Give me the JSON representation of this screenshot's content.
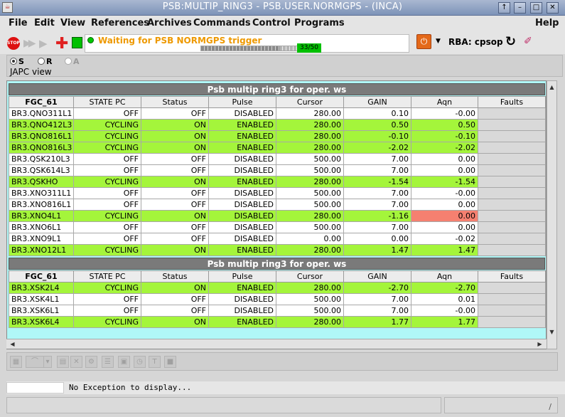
{
  "window": {
    "title": "PSB:MULTIP_RING3 - PSB.USER.NORMGPS - (INCA)",
    "app_icon": "java-icon",
    "buttons": [
      "↑",
      "–",
      "□",
      "✕"
    ]
  },
  "menu": [
    "File",
    "Edit",
    "View",
    "References",
    "Archives",
    "Commands",
    "Control",
    "Programs",
    "Help"
  ],
  "toolbar": {
    "stop_label": "STOP",
    "status_text": "Waiting for PSB NORMGPS trigger",
    "progress": {
      "current": 33,
      "total": 50,
      "label": "33/50"
    },
    "rba_label": "RBA: cpsop",
    "status_color": "#00c800",
    "status_text_color": "#ee9900"
  },
  "radios": [
    {
      "label": "S",
      "selected": true,
      "enabled": true
    },
    {
      "label": "R",
      "selected": false,
      "enabled": true
    },
    {
      "label": "A",
      "selected": false,
      "enabled": false
    }
  ],
  "view_label": "JAPC view",
  "colors": {
    "cycling_row": "#a4f53b",
    "alarm_cell": "#f58070",
    "background": "#b0f7f7"
  },
  "columns": [
    "FGC_61",
    "STATE PC",
    "Status",
    "Pulse",
    "Cursor",
    "GAIN",
    "Aqn",
    "Faults"
  ],
  "sections": [
    {
      "title": "Psb multip ring3 for oper. ws",
      "rows": [
        {
          "name": "BR3.QNO311L1",
          "state": "OFF",
          "status": "OFF",
          "pulse": "DISABLED",
          "cursor": "280.00",
          "gain": "0.10",
          "aqn": "-0.00",
          "faults": "",
          "cycling": false,
          "alarm": false
        },
        {
          "name": "BR3.QNO412L3",
          "state": "CYCLING",
          "status": "ON",
          "pulse": "ENABLED",
          "cursor": "280.00",
          "gain": "0.50",
          "aqn": "0.50",
          "faults": "",
          "cycling": true,
          "alarm": false
        },
        {
          "name": "BR3.QNO816L1",
          "state": "CYCLING",
          "status": "ON",
          "pulse": "ENABLED",
          "cursor": "280.00",
          "gain": "-0.10",
          "aqn": "-0.10",
          "faults": "",
          "cycling": true,
          "alarm": false
        },
        {
          "name": "BR3.QNO816L3",
          "state": "CYCLING",
          "status": "ON",
          "pulse": "ENABLED",
          "cursor": "280.00",
          "gain": "-2.02",
          "aqn": "-2.02",
          "faults": "",
          "cycling": true,
          "alarm": false
        },
        {
          "name": "BR3.QSK210L3",
          "state": "OFF",
          "status": "OFF",
          "pulse": "DISABLED",
          "cursor": "500.00",
          "gain": "7.00",
          "aqn": "0.00",
          "faults": "",
          "cycling": false,
          "alarm": false
        },
        {
          "name": "BR3.QSK614L3",
          "state": "OFF",
          "status": "OFF",
          "pulse": "DISABLED",
          "cursor": "500.00",
          "gain": "7.00",
          "aqn": "0.00",
          "faults": "",
          "cycling": false,
          "alarm": false
        },
        {
          "name": "BR3.QSKHO",
          "state": "CYCLING",
          "status": "ON",
          "pulse": "ENABLED",
          "cursor": "280.00",
          "gain": "-1.54",
          "aqn": "-1.54",
          "faults": "",
          "cycling": true,
          "alarm": false
        },
        {
          "name": "BR3.XNO311L1",
          "state": "OFF",
          "status": "OFF",
          "pulse": "DISABLED",
          "cursor": "500.00",
          "gain": "7.00",
          "aqn": "-0.00",
          "faults": "",
          "cycling": false,
          "alarm": false
        },
        {
          "name": "BR3.XNO816L1",
          "state": "OFF",
          "status": "OFF",
          "pulse": "DISABLED",
          "cursor": "500.00",
          "gain": "7.00",
          "aqn": "0.00",
          "faults": "",
          "cycling": false,
          "alarm": false
        },
        {
          "name": "BR3.XNO4L1",
          "state": "CYCLING",
          "status": "ON",
          "pulse": "DISABLED",
          "cursor": "280.00",
          "gain": "-1.16",
          "aqn": "0.00",
          "faults": "",
          "cycling": true,
          "alarm": true
        },
        {
          "name": "BR3.XNO6L1",
          "state": "OFF",
          "status": "OFF",
          "pulse": "DISABLED",
          "cursor": "500.00",
          "gain": "7.00",
          "aqn": "0.00",
          "faults": "",
          "cycling": false,
          "alarm": false
        },
        {
          "name": "BR3.XNO9L1",
          "state": "OFF",
          "status": "OFF",
          "pulse": "DISABLED",
          "cursor": "0.00",
          "gain": "0.00",
          "aqn": "-0.02",
          "faults": "",
          "cycling": false,
          "alarm": false
        },
        {
          "name": "BR3.XNO12L1",
          "state": "CYCLING",
          "status": "ON",
          "pulse": "ENABLED",
          "cursor": "280.00",
          "gain": "1.47",
          "aqn": "1.47",
          "faults": "",
          "cycling": true,
          "alarm": false
        }
      ]
    },
    {
      "title": "Psb multip ring3 for oper. ws",
      "rows": [
        {
          "name": "BR3.XSK2L4",
          "state": "CYCLING",
          "status": "ON",
          "pulse": "ENABLED",
          "cursor": "280.00",
          "gain": "-2.70",
          "aqn": "-2.70",
          "faults": "",
          "cycling": true,
          "alarm": false
        },
        {
          "name": "BR3.XSK4L1",
          "state": "OFF",
          "status": "OFF",
          "pulse": "DISABLED",
          "cursor": "500.00",
          "gain": "7.00",
          "aqn": "0.01",
          "faults": "",
          "cycling": false,
          "alarm": false
        },
        {
          "name": "BR3.XSK6L1",
          "state": "OFF",
          "status": "OFF",
          "pulse": "DISABLED",
          "cursor": "500.00",
          "gain": "7.00",
          "aqn": "-0.00",
          "faults": "",
          "cycling": false,
          "alarm": false
        },
        {
          "name": "BR3.XSK6L4",
          "state": "CYCLING",
          "status": "ON",
          "pulse": "ENABLED",
          "cursor": "280.00",
          "gain": "1.77",
          "aqn": "1.77",
          "faults": "",
          "cycling": true,
          "alarm": false
        }
      ]
    }
  ],
  "bottom_toolbar_icons": [
    "select-icon",
    "curve-icon",
    "dropdown-icon",
    "ppm-icon",
    "tools-icon",
    "gear-icon",
    "list-icon",
    "grid-icon",
    "clock-icon",
    "text-icon",
    "square-icon"
  ],
  "exception": {
    "text": "No Exception to display..."
  },
  "status_bar": {
    "grip": "∕"
  }
}
